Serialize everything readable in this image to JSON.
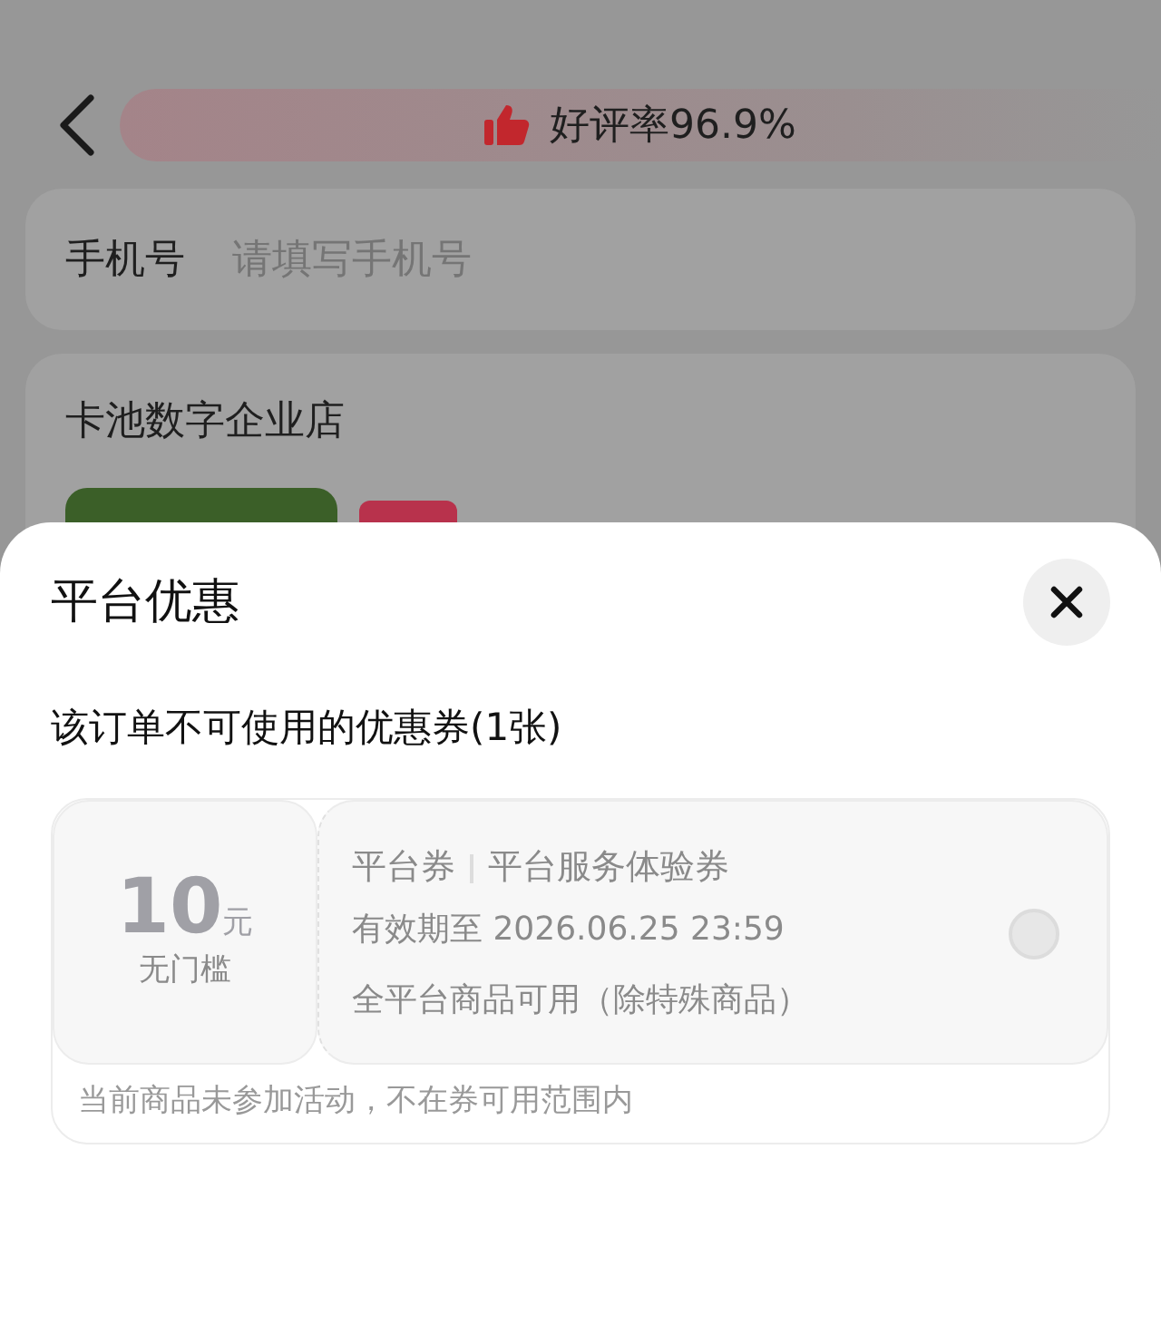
{
  "header": {
    "rating": "好评率96.9%"
  },
  "phone": {
    "label": "手机号",
    "placeholder": "请填写手机号"
  },
  "shop": {
    "name": "卡池数字企业店"
  },
  "sheet": {
    "title": "平台优惠",
    "section": "该订单不可使用的优惠券(1张)",
    "coupons": [
      {
        "amount": "10",
        "unit": "元",
        "threshold": "无门槛",
        "type": "平台券",
        "name": "平台服务体验券",
        "validity": "有效期至 2026.06.25 23:59",
        "scope": "全平台商品可用（除特殊商品）",
        "selected": false,
        "disabled": true,
        "note": "当前商品未参加活动，不在券可用范围内"
      }
    ]
  }
}
